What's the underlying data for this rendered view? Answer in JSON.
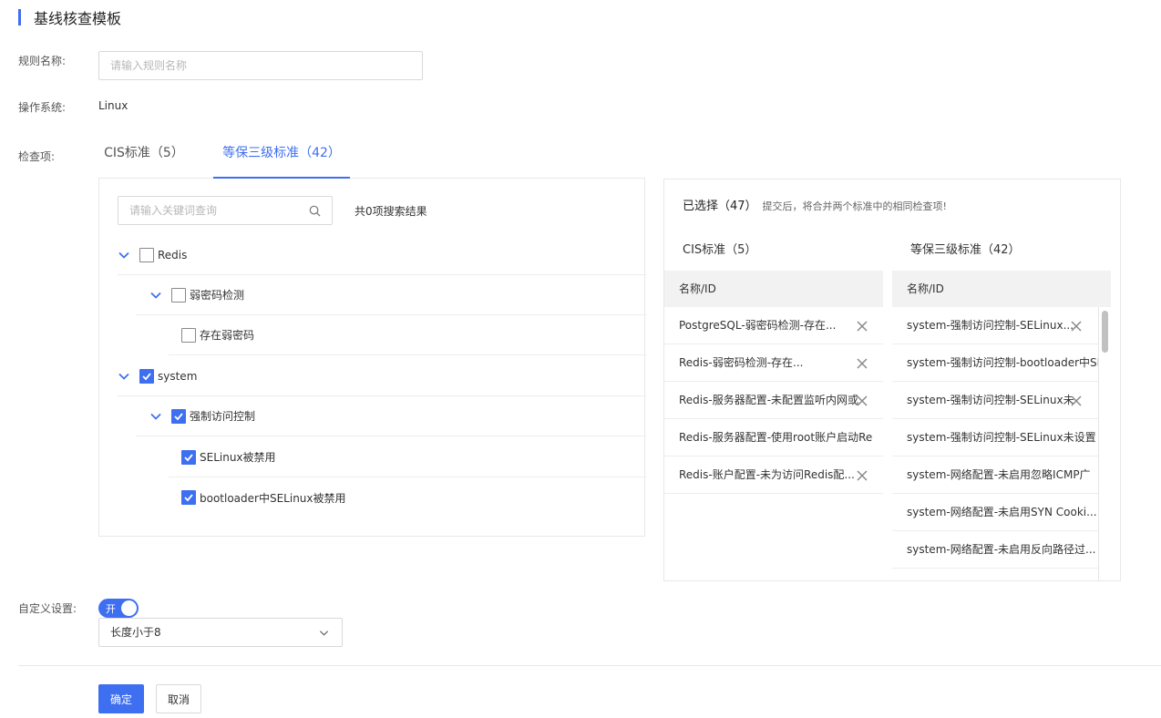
{
  "page": {
    "title": "基线核查模板"
  },
  "form": {
    "rule_name_label": "规则名称:",
    "rule_name_placeholder": "请输入规则名称",
    "rule_name_value": "",
    "os_label": "操作系统:",
    "os_value": "Linux",
    "items_label": "检查项:",
    "custom_label": "自定义设置:"
  },
  "tabs": [
    {
      "label": "CIS标准（5）",
      "active": false
    },
    {
      "label": "等保三级标准（42）",
      "active": true
    }
  ],
  "search": {
    "placeholder": "请输入关键词查询",
    "value": "",
    "result_text": "共0项搜索结果"
  },
  "tree": [
    {
      "label": "Redis",
      "checked": false,
      "expanded": true
    },
    {
      "label": "弱密码检测",
      "checked": false,
      "expanded": true
    },
    {
      "label": "存在弱密码",
      "checked": false
    },
    {
      "label": "system",
      "checked": true,
      "expanded": true
    },
    {
      "label": "强制访问控制",
      "checked": true,
      "expanded": true
    },
    {
      "label": "SELinux被禁用",
      "checked": true
    },
    {
      "label": "bootloader中SELinux被禁用",
      "checked": true
    }
  ],
  "selected": {
    "count_text": "已选择（47）",
    "tip": "提交后，将合并两个标准中的相同检查项!",
    "cis": {
      "title": "CIS标准（5）",
      "column": "名称/ID",
      "rows": [
        "PostgreSQL-弱密码检测-存在...",
        "Redis-弱密码检测-存在...",
        "Redis-服务器配置-未配置监听内网或",
        "Redis-服务器配置-使用root账户启动Re",
        "Redis-账户配置-未为访问Redis配..."
      ]
    },
    "dengbao": {
      "title": "等保三级标准（42）",
      "column": "名称/ID",
      "rows": [
        "system-强制访问控制-SELinux...",
        "system-强制访问控制-bootloader中SE",
        "system-强制访问控制-SELinux未",
        "system-强制访问控制-SELinux未设置",
        "system-网络配置-未启用忽略ICMP广",
        "system-网络配置-未启用SYN Cooki...",
        "system-网络配置-未启用反向路径过..."
      ]
    }
  },
  "custom": {
    "toggle_text": "开",
    "toggle_on": true,
    "select_value": "长度小于8"
  },
  "buttons": {
    "ok": "确定",
    "cancel": "取消"
  },
  "colors": {
    "accent": "#3e6ff0"
  }
}
